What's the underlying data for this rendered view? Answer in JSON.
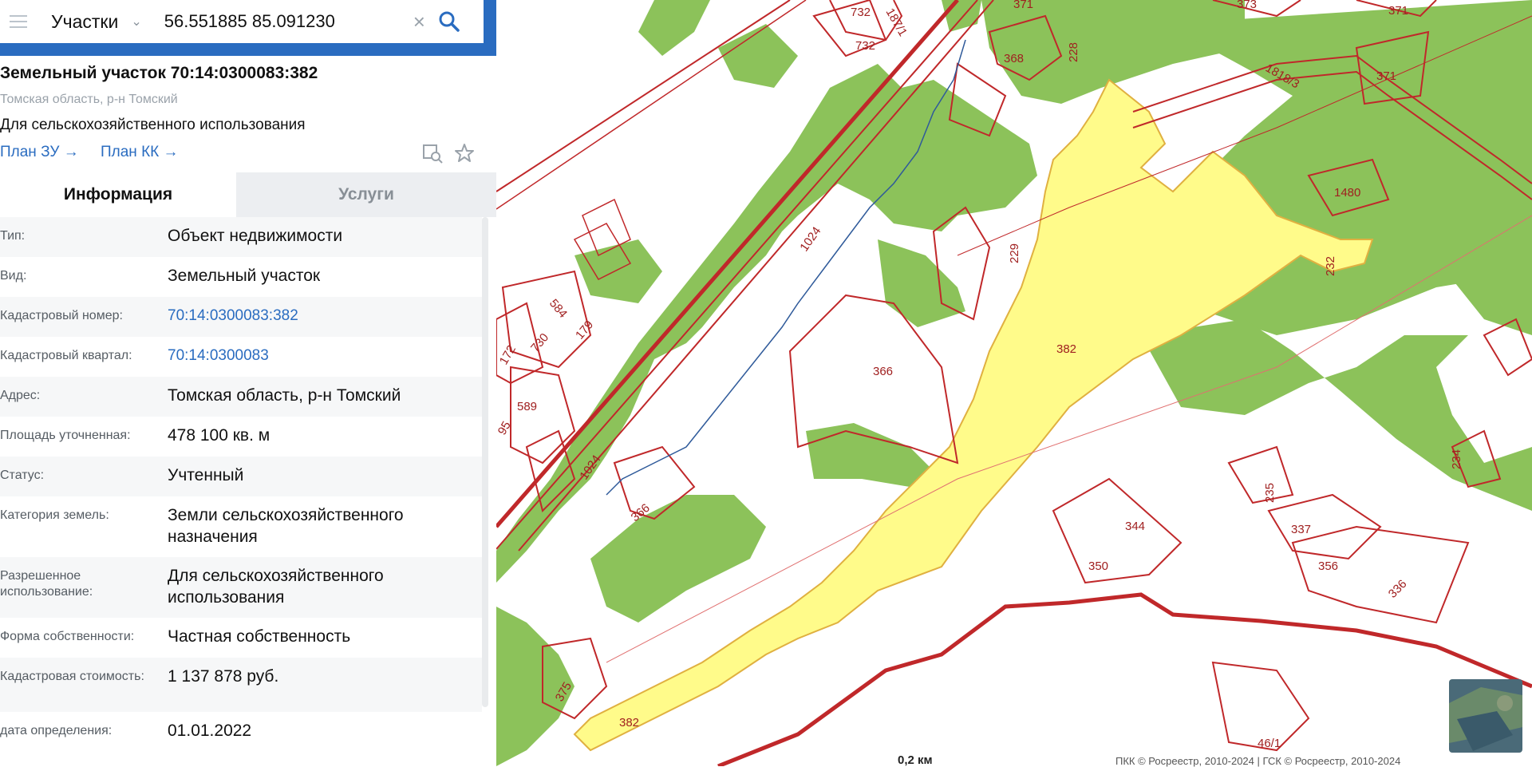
{
  "search": {
    "layer": "Участки",
    "query": "56.551885 85.091230"
  },
  "parcel": {
    "title": "Земельный участок 70:14:0300083:382",
    "subtitle": "Томская область, р-н Томский",
    "purpose": "Для сельскохозяйственного использования",
    "plan_zu": "План ЗУ",
    "plan_kk": "План КК"
  },
  "tabs": [
    {
      "label": "Информация",
      "active": true
    },
    {
      "label": "Услуги",
      "active": false
    }
  ],
  "info_rows": [
    {
      "label": "Тип:",
      "value": "Объект недвижимости"
    },
    {
      "label": "Вид:",
      "value": "Земельный участок"
    },
    {
      "label": "Кадастровый номер:",
      "value": "70:14:0300083:382"
    },
    {
      "label": "Кадастровый квартал:",
      "value": "70:14:0300083"
    },
    {
      "label": "Адрес:",
      "value": "Томская область, р-н Томский"
    },
    {
      "label": "Площадь уточненная:",
      "value": "478 100 кв. м"
    },
    {
      "label": "Статус:",
      "value": "Учтенный"
    },
    {
      "label": "Категория земель:",
      "value": "Земли сельскохозяйственного назначения"
    },
    {
      "label": "Разрешенное использование:",
      "value": "Для сельскохозяйственного использования"
    },
    {
      "label": "Форма собственности:",
      "value": "Частная собственность"
    },
    {
      "label": "Кадастровая стоимость:",
      "value": "1 137 878 руб."
    },
    {
      "label": "дата определения:",
      "value": "01.01.2022"
    }
  ],
  "map_labels": [
    "732",
    "732",
    "187/1",
    "371",
    "373",
    "371",
    "368",
    "228",
    "1818/3",
    "371",
    "1480",
    "1024",
    "229",
    "232",
    "584",
    "730",
    "179",
    "172",
    "366",
    "382",
    "589",
    "95",
    "1024",
    "366",
    "235",
    "234",
    "337",
    "344",
    "350",
    "356",
    "336",
    "375",
    "382",
    "46/1"
  ],
  "scale": "0,2 км",
  "attribution": "ПКК © Росреестр, 2010-2024 | ГСК © Росреестр, 2010-2024",
  "colors": {
    "accent": "#2a6cc0",
    "parcel_border": "#c0282a",
    "selected_fill": "#fffb8a",
    "vegetation": "#8cc25a"
  },
  "icons": {
    "menu": "menu-icon",
    "search": "search-icon",
    "clear": "clear-icon",
    "compare": "compare-icon",
    "favorite": "star-icon"
  }
}
